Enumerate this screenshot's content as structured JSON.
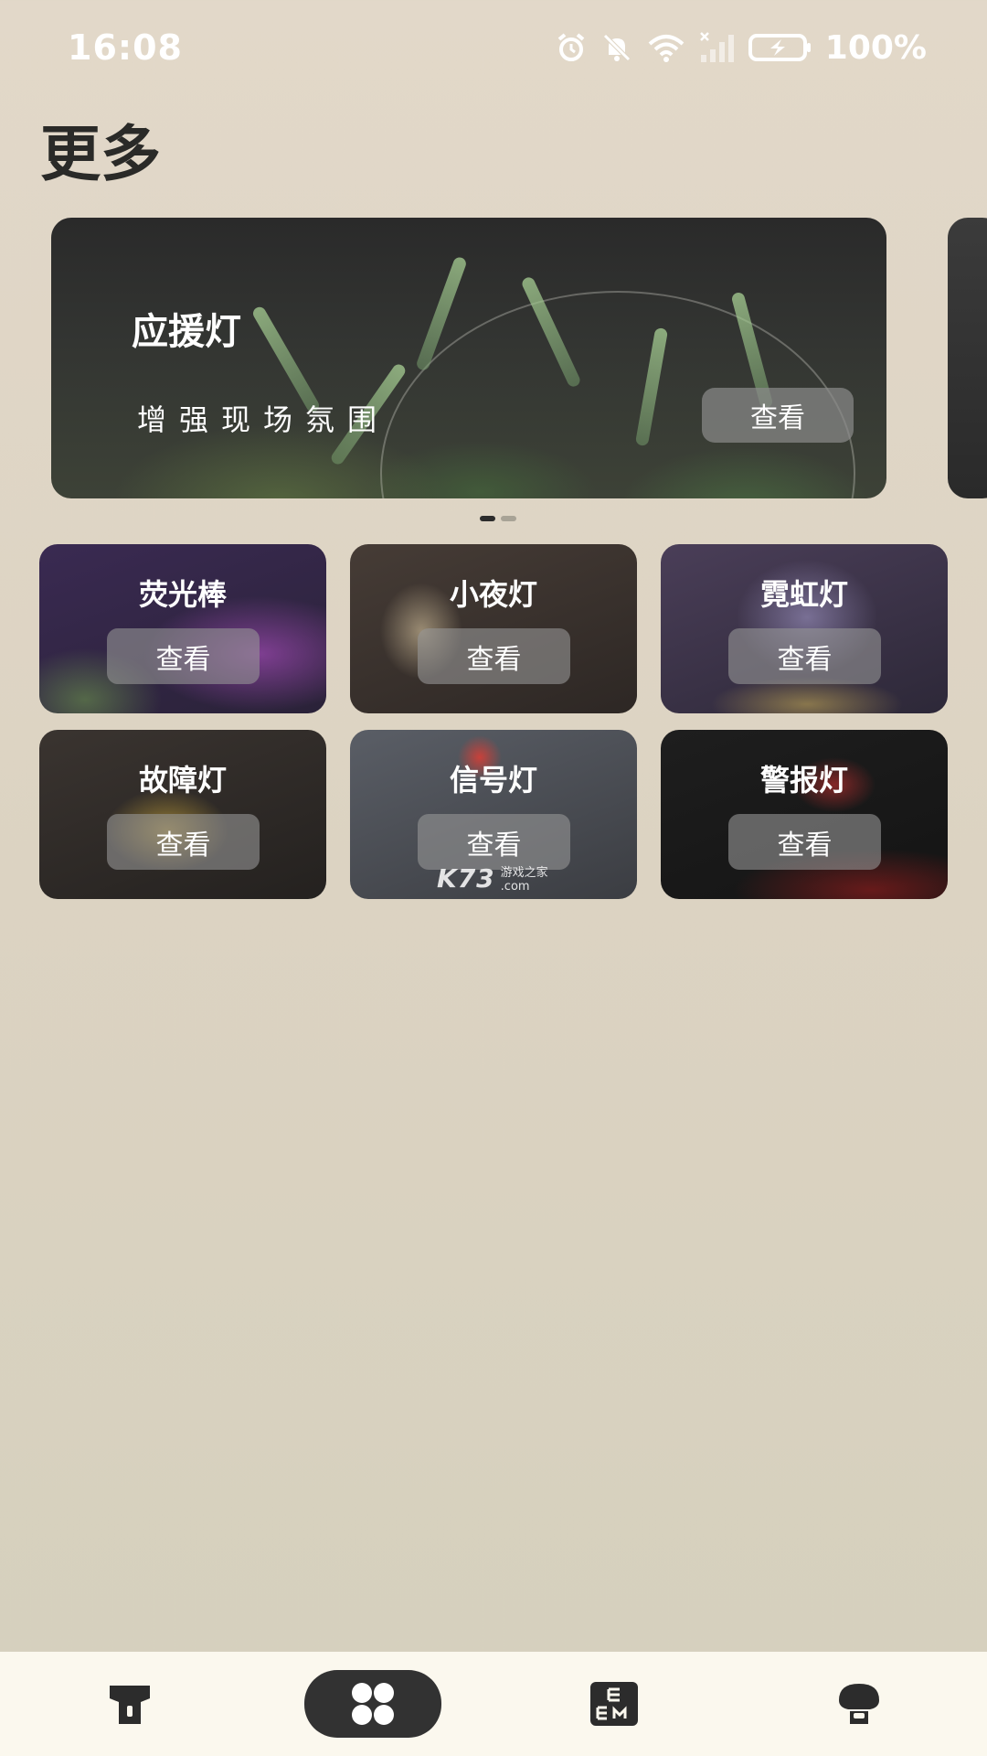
{
  "status_bar": {
    "time": "16:08",
    "battery": "100%",
    "icons": [
      "alarm-icon",
      "bell-muted-icon",
      "wifi-icon",
      "signal-icon",
      "battery-charging-icon"
    ]
  },
  "page": {
    "title": "更多"
  },
  "hero": {
    "title": "应援灯",
    "subtitle": "增强现场氛围",
    "button_label": "查看",
    "pager": {
      "count": 2,
      "active": 0
    }
  },
  "cards": [
    {
      "title": "荧光棒",
      "button_label": "查看"
    },
    {
      "title": "小夜灯",
      "button_label": "查看"
    },
    {
      "title": "霓虹灯",
      "button_label": "查看"
    },
    {
      "title": "故障灯",
      "button_label": "查看"
    },
    {
      "title": "信号灯",
      "button_label": "查看"
    },
    {
      "title": "警报灯",
      "button_label": "查看"
    }
  ],
  "watermark": {
    "main": "K73",
    "cn": "游戏之家",
    "domain": ".com"
  },
  "bottom_nav": {
    "items": [
      {
        "icon": "flashlight-icon",
        "active": false
      },
      {
        "icon": "grid-icon",
        "active": true
      },
      {
        "icon": "board-icon",
        "active": false
      },
      {
        "icon": "lamp-icon",
        "active": false
      }
    ]
  },
  "colors": {
    "background_top": "#e2d8c9",
    "background_bottom": "#d5d0bd",
    "nav_background": "#fbf8ee",
    "nav_active": "#323232"
  }
}
